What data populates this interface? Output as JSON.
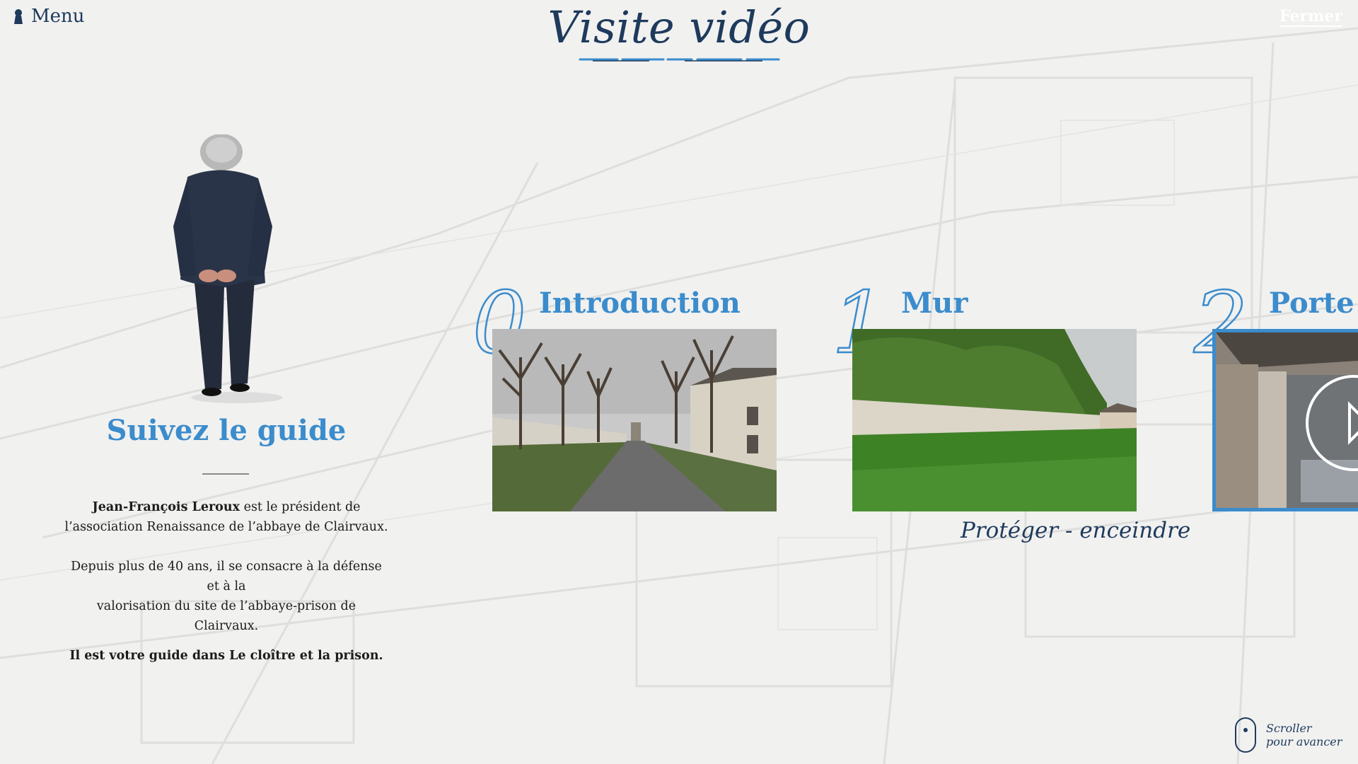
{
  "header": {
    "menu_label": "Menu",
    "title": "Visite vidéo",
    "close_label": "Fermer"
  },
  "guide": {
    "heading": "Suivez le guide",
    "name": "Jean-François Leroux",
    "intro_rest_line1": " est le président de",
    "intro_line2": "l’association Renaissance de l’abbaye de Clairvaux.",
    "paragraph2_line1": "Depuis plus de 40 ans, il se consacre à la défense et à la",
    "paragraph2_line2": "valorisation du site de l’abbaye-prison de Clairvaux.",
    "closing": "Il est votre guide dans Le cloître et la prison."
  },
  "chapters": [
    {
      "number": "0",
      "title": "Introduction",
      "subtitle": ""
    },
    {
      "number": "1",
      "title": "Mur",
      "subtitle": "Protéger - enceindre"
    },
    {
      "number": "2",
      "title": "Porte",
      "subtitle": ""
    }
  ],
  "scroll_hint": {
    "line1": "Scroller",
    "line2": "pour avancer"
  },
  "colors": {
    "accent": "#3b8ccc",
    "navy": "#1e3a5c",
    "background": "#f1f1f0"
  },
  "icons": {
    "menu": "keyhole-icon",
    "play": "play-icon",
    "scroll": "mouse-scroll-icon"
  }
}
